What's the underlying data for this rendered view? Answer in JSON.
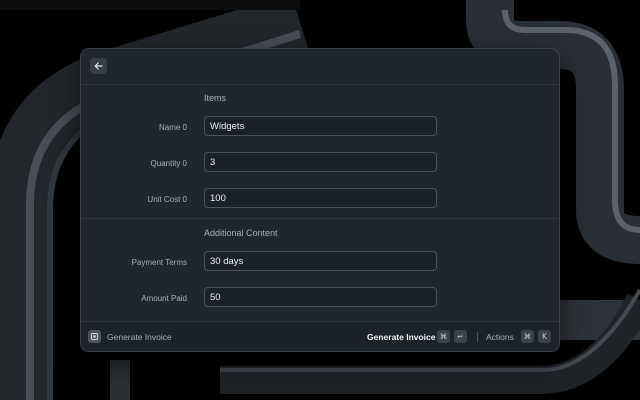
{
  "form": {
    "sections": [
      {
        "title": "Items",
        "fields": [
          {
            "label": "Name 0",
            "value": "Widgets"
          },
          {
            "label": "Quantity 0",
            "value": "3"
          },
          {
            "label": "Unit Cost 0",
            "value": "100"
          }
        ]
      },
      {
        "title": "Additional Content",
        "fields": [
          {
            "label": "Payment Terms",
            "value": "30 days"
          },
          {
            "label": "Amount Paid",
            "value": "50"
          },
          {
            "label": "",
            "value": ""
          }
        ]
      }
    ]
  },
  "footer": {
    "title": "Generate Invoice",
    "primary_action": "Generate Invoice",
    "primary_keys": [
      "⌘",
      "↵"
    ],
    "actions_label": "Actions",
    "actions_keys": [
      "⌘",
      "K"
    ]
  },
  "icons": {
    "back": "arrow-left-icon",
    "extension": "extension-icon"
  },
  "colors": {
    "window_bg": "#1f262e",
    "field_border": "#48525e",
    "text_muted": "#a8b1bc",
    "text_primary": "#eef1f4"
  }
}
